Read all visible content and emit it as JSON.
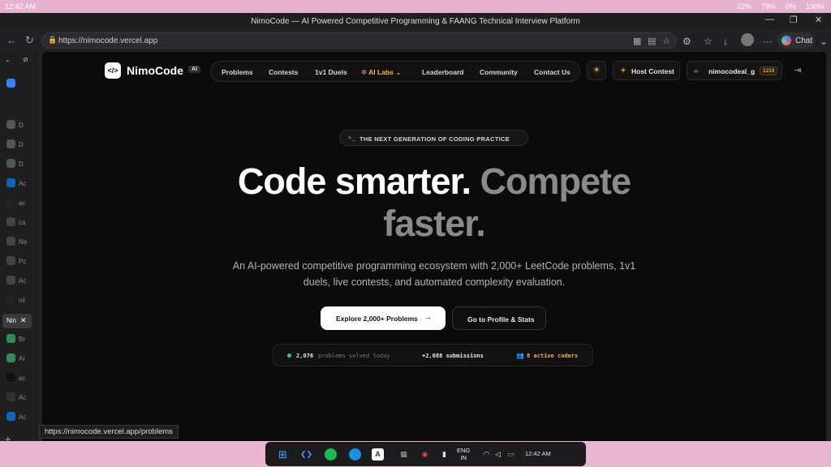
{
  "statusbar": {
    "time": "12:42 AM",
    "cpu": "22%",
    "mem": "79%",
    "wifi": "0%",
    "battery": "100%"
  },
  "window": {
    "title": "NimoCode — AI Powered Competitive Programming & FAANG Technical Interview Platform"
  },
  "address": {
    "url": "https://nimocode.vercel.app",
    "chat_label": "Chat"
  },
  "sidetabs": {
    "items": [
      {
        "label": "D"
      },
      {
        "label": "D"
      },
      {
        "label": "D"
      },
      {
        "label": "Ac"
      },
      {
        "label": "ac"
      },
      {
        "label": "ca"
      },
      {
        "label": "Ne"
      },
      {
        "label": "Pc"
      },
      {
        "label": "Ac"
      },
      {
        "label": "nii"
      },
      {
        "label": "Br"
      },
      {
        "label": "AI"
      },
      {
        "label": "ac"
      },
      {
        "label": "Ac"
      },
      {
        "label": "Ac"
      }
    ],
    "active_label": "Nin"
  },
  "nav": {
    "logo_name": "NimoCode",
    "logo_badge": "AI",
    "items": [
      {
        "label": "Problems"
      },
      {
        "label": "Contests"
      },
      {
        "label": "1v1 Duels"
      },
      {
        "label": "AI Labs"
      },
      {
        "label": "Leaderboard"
      },
      {
        "label": "Community"
      },
      {
        "label": "Contact Us"
      }
    ],
    "host_label": "Host Contest",
    "username": "nimocodeal_g",
    "rating": "1215"
  },
  "hero": {
    "badge": "THE NEXT GENERATION OF CODING PRACTICE",
    "title_white": "Code smarter.",
    "title_gray_1": "Compete",
    "title_gray_2": "faster.",
    "subtitle": "An AI-powered competitive programming ecosystem with 2,000+ LeetCode problems, 1v1 duels, live contests, and automated complexity evaluation.",
    "primary_cta": "Explore 2,000+ Problems",
    "secondary_cta": "Go to Profile & Stats"
  },
  "stats": {
    "solved_count": "2,076",
    "solved_text": "problems solved today",
    "submissions": "+2,088 submissions",
    "active": "8 active coders"
  },
  "hover_url": "https://nimocode.vercel.app/problems",
  "taskbar": {
    "lang_1": "ENG",
    "lang_2": "IN",
    "time": "12:42 AM"
  }
}
